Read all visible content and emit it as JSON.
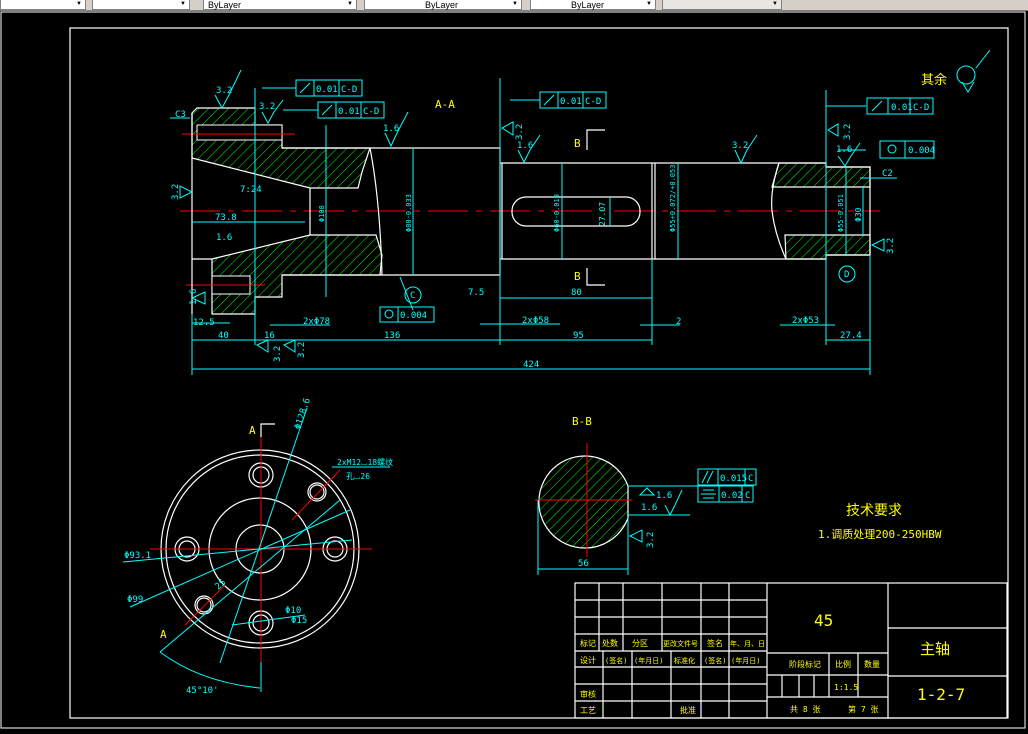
{
  "toolbar": {
    "controls": [
      {
        "name": "layer-control",
        "label": ""
      },
      {
        "name": "text-style-control",
        "label": ""
      },
      {
        "name": "color-control",
        "label": "ByLayer"
      },
      {
        "name": "linetype-control",
        "label": "ByLayer"
      },
      {
        "name": "lineweight-control",
        "label": "ByLayer"
      },
      {
        "name": "plotstyle-control",
        "label": ""
      }
    ]
  },
  "colors": {
    "background": "#000000",
    "outline": "#ffffff",
    "dimension": "#00ffff",
    "text": "#ffff00",
    "centerline": "#ff0000",
    "hatch": "#00ff00",
    "toolbar": "#d4d0c8"
  },
  "section_aa": {
    "title": "A-A",
    "cut_label_top": "B",
    "cut_label_bottom": "B",
    "general_roughness": "其余",
    "labels": [
      "C3",
      "3.2",
      "3.2",
      "1.6",
      "1.6",
      "3.2",
      "1.6",
      "7:24",
      "73.8",
      "1.6",
      "12.5",
      "40",
      "16",
      "2xΦ78",
      "136",
      "7.5",
      "80",
      "2xΦ58",
      "95",
      "2",
      "2xΦ53",
      "27.4",
      "424",
      "C2",
      "3.2",
      "1.6",
      "3.2",
      "3.2",
      "3.2",
      "3.2",
      "3.2"
    ],
    "vertical_dims": [
      "Φ108",
      "Φ80-0.033",
      "Φ60-0.019",
      "27.07",
      "Φ55+0.072/+0.053",
      "Φ55-0.051",
      "Φ30"
    ],
    "gdt": [
      {
        "symbol": "circular-runout",
        "tolerance": "0.01",
        "datum": "C-D"
      },
      {
        "symbol": "circular-runout",
        "tolerance": "0.01",
        "datum": "C-D"
      },
      {
        "symbol": "circular-runout",
        "tolerance": "0.01",
        "datum": "C-D"
      },
      {
        "symbol": "circular-runout",
        "tolerance": "0.01",
        "datum": "C-D"
      },
      {
        "symbol": "cylindricity",
        "tolerance": "0.004",
        "datum": ""
      },
      {
        "symbol": "cylindricity",
        "tolerance": "0.004",
        "datum": ""
      }
    ],
    "datums": [
      "C",
      "D"
    ]
  },
  "end_view": {
    "cut_label_top": "A",
    "cut_label_bottom": "A",
    "labels": [
      "Φ128.6",
      "2xM12⌴18螺纹",
      "孔⌴26",
      "Φ93.1",
      "Φ99",
      "Φ10",
      "Φ15",
      "45°10'",
      "25"
    ]
  },
  "section_bb": {
    "title": "B-B",
    "labels": [
      "56",
      "1.6",
      "1.6",
      "3.2"
    ],
    "gdt": [
      {
        "symbol": "parallelism",
        "tolerance": "0.015",
        "datum": "C"
      },
      {
        "symbol": "symmetry",
        "tolerance": "0.02",
        "datum": "C"
      }
    ]
  },
  "tech_requirements": {
    "title": "技术要求",
    "items": [
      "1.调质处理200-250HBW"
    ]
  },
  "title_block": {
    "row_headers_1": [
      "标记",
      "处数",
      "分区",
      "更改文件号",
      "签名",
      "年、月、日"
    ],
    "row_headers_2": [
      "设计",
      "(签名)",
      "(年月日)",
      "标准化",
      "(签名)",
      "(年月日)"
    ],
    "review": "审核",
    "process": "工艺",
    "approve": "批准",
    "material": "45",
    "stage_mark": "阶段标记",
    "scale_label": "比例",
    "quantity_label": "数量",
    "scale": "1:1.5",
    "sheets_total": "共 8 张",
    "sheet_no": "第 7 张",
    "part_name": "主轴",
    "drawing_no": "1-2-7"
  }
}
